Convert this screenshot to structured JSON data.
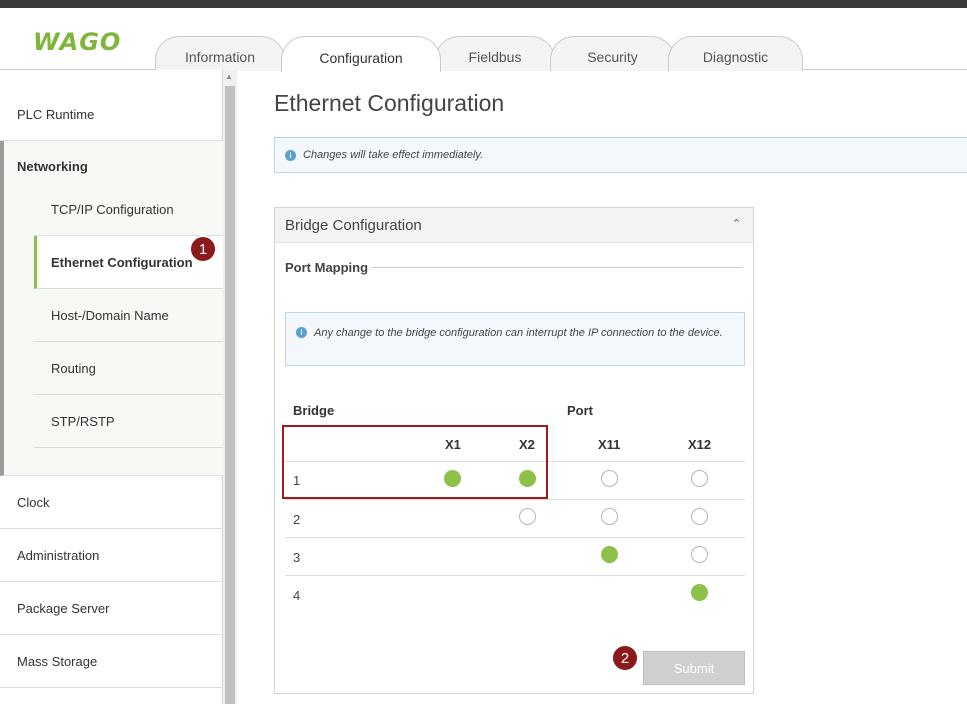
{
  "brand": {
    "logo_text": "WAGO",
    "accent": "#8dc14a",
    "badge_color": "#8b1a1a"
  },
  "tabs": [
    {
      "label": "Information",
      "active": false
    },
    {
      "label": "Configuration",
      "active": true
    },
    {
      "label": "Fieldbus",
      "active": false
    },
    {
      "label": "Security",
      "active": false
    },
    {
      "label": "Diagnostic",
      "active": false
    }
  ],
  "sidebar": {
    "items": [
      {
        "label": "PLC Runtime"
      },
      {
        "label": "Networking"
      },
      {
        "label": "Clock"
      },
      {
        "label": "Administration"
      },
      {
        "label": "Package Server"
      },
      {
        "label": "Mass Storage"
      }
    ],
    "networking_sub": [
      {
        "label": "TCP/IP Configuration",
        "active": false
      },
      {
        "label": "Ethernet Configuration",
        "active": true
      },
      {
        "label": "Host-/Domain Name",
        "active": false
      },
      {
        "label": "Routing",
        "active": false
      },
      {
        "label": "STP/RSTP",
        "active": false
      }
    ]
  },
  "badges": {
    "one": "1",
    "two": "2"
  },
  "main": {
    "title": "Ethernet Configuration",
    "notice": "Changes will take effect immediately.",
    "panel": {
      "title": "Bridge Configuration",
      "section": "Port Mapping",
      "warning": "Any change to the bridge configuration can interrupt the IP connection to the device.",
      "bridge_header": "Bridge",
      "port_header": "Port",
      "ports": [
        "X1",
        "X2",
        "X11",
        "X12"
      ],
      "rows": [
        {
          "bridge": "1",
          "cells": [
            "on",
            "on",
            "off",
            "off"
          ]
        },
        {
          "bridge": "2",
          "cells": [
            "none",
            "off",
            "off",
            "off"
          ]
        },
        {
          "bridge": "3",
          "cells": [
            "none",
            "none",
            "on",
            "off"
          ]
        },
        {
          "bridge": "4",
          "cells": [
            "none",
            "none",
            "none",
            "on"
          ]
        }
      ],
      "submit_label": "Submit"
    }
  }
}
